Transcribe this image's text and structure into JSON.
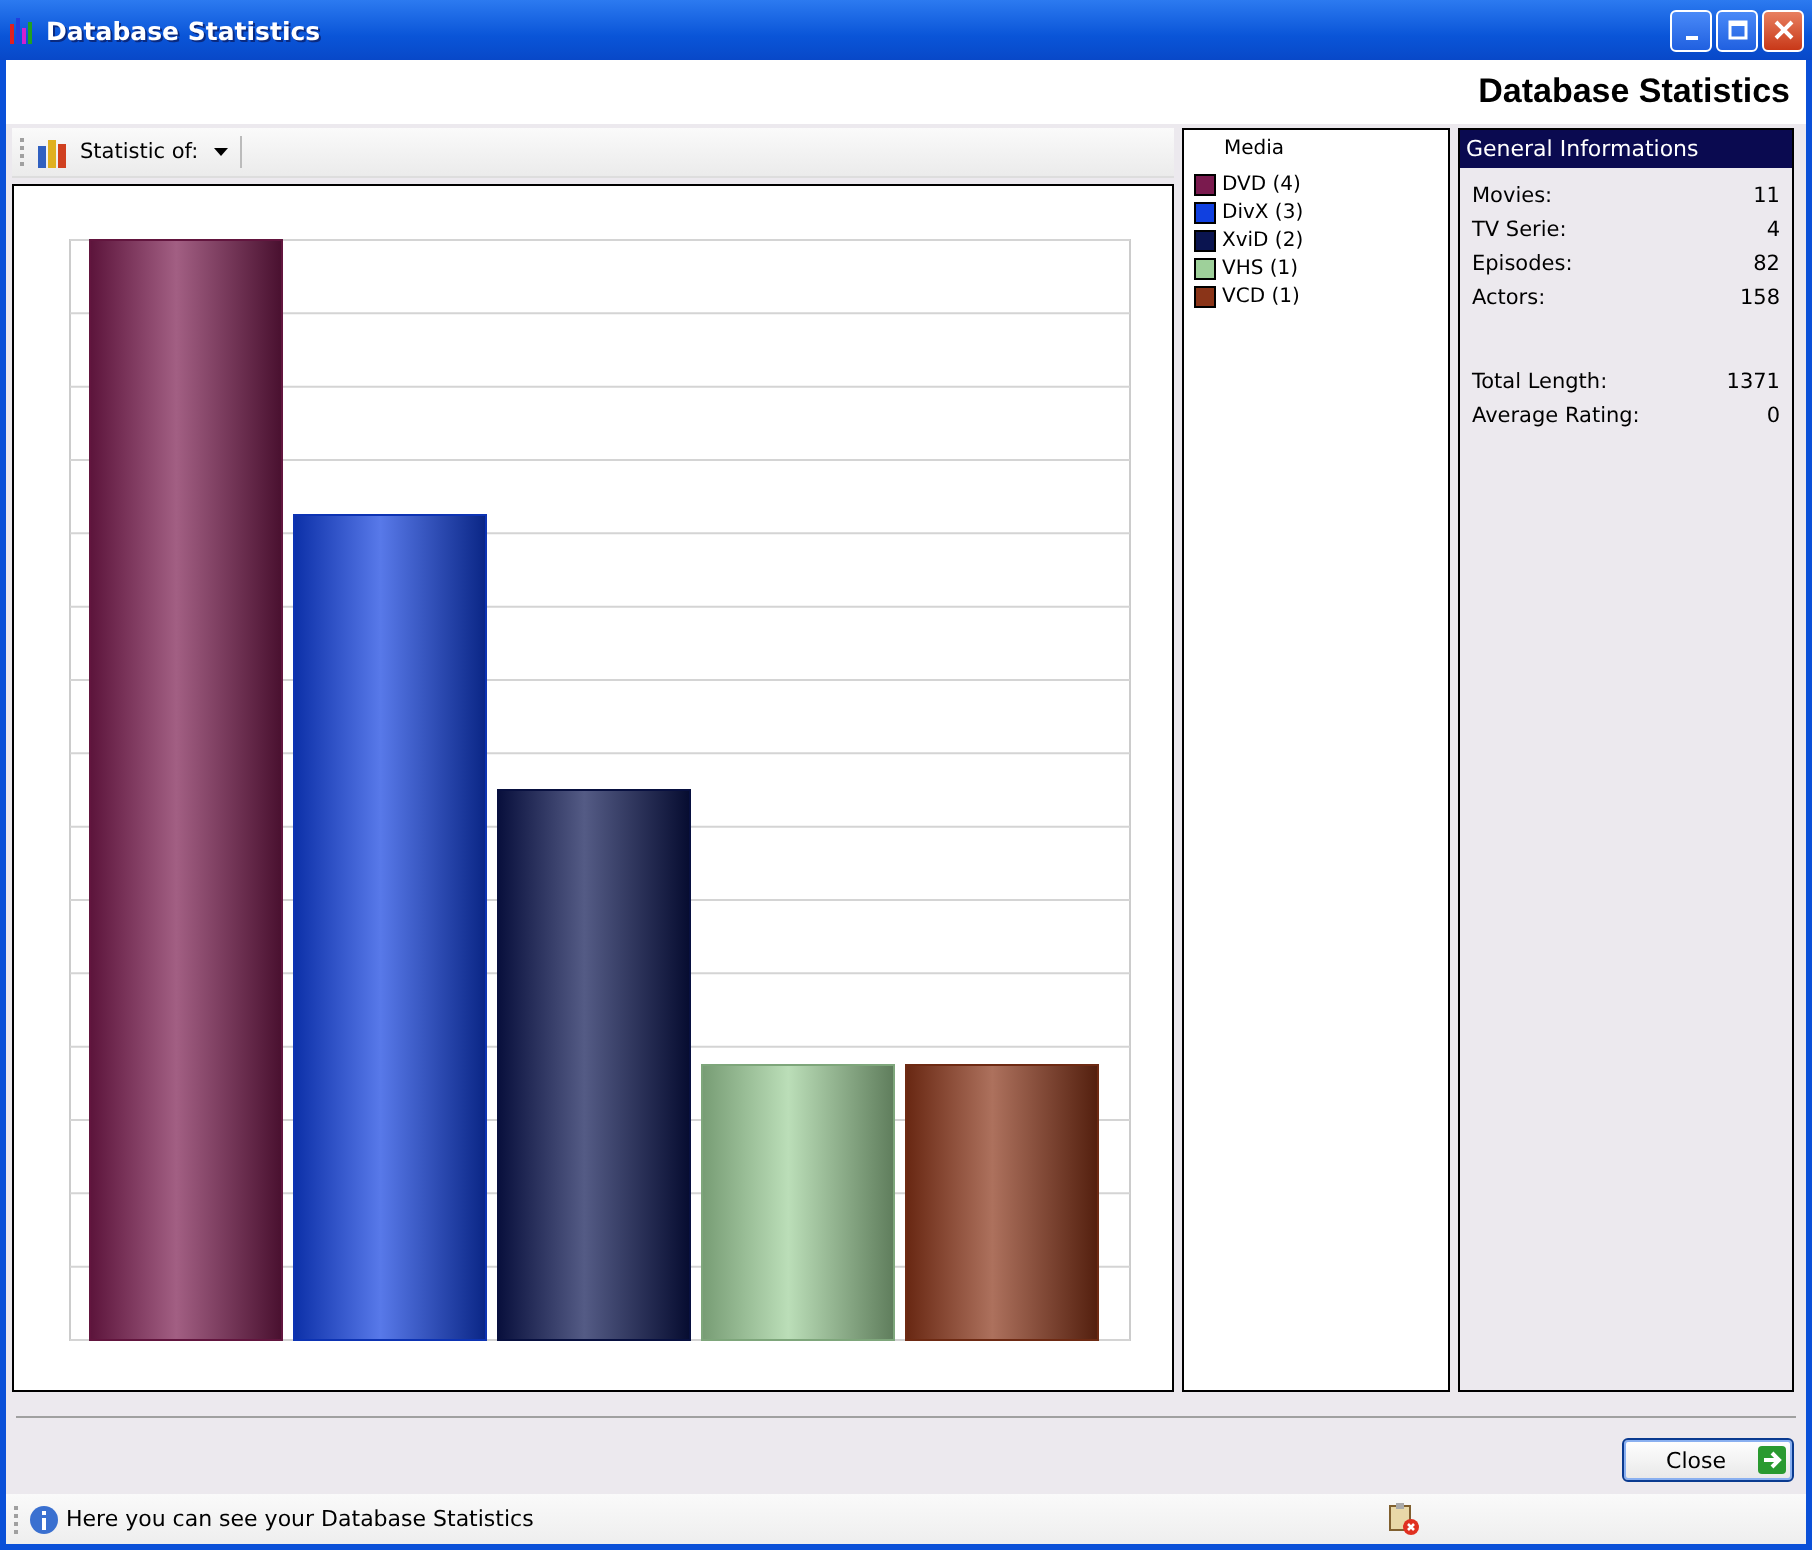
{
  "window": {
    "title": "Database Statistics"
  },
  "header": {
    "title": "Database Statistics"
  },
  "toolbar": {
    "label": "Statistic of:"
  },
  "legend": {
    "title": "Media",
    "items": [
      {
        "label": "DVD (4)",
        "color": "#7a1a4e"
      },
      {
        "label": "DivX (3)",
        "color": "#1040e0"
      },
      {
        "label": "XviD (2)",
        "color": "#0a1450"
      },
      {
        "label": "VHS (1)",
        "color": "#9ed09a"
      },
      {
        "label": "VCD (1)",
        "color": "#8a3418"
      }
    ]
  },
  "info": {
    "title": "General Informations",
    "groups": [
      [
        {
          "label": "Movies:",
          "value": "11"
        },
        {
          "label": "TV Serie:",
          "value": "4"
        },
        {
          "label": "Episodes:",
          "value": "82"
        },
        {
          "label": "Actors:",
          "value": "158"
        }
      ],
      [
        {
          "label": "Total Length:",
          "value": "1371"
        },
        {
          "label": "Average Rating:",
          "value": "0"
        }
      ]
    ]
  },
  "buttons": [
    {
      "label": "Close"
    }
  ],
  "status_bar": {
    "text": "Here you can see your Database Statistics"
  }
}
